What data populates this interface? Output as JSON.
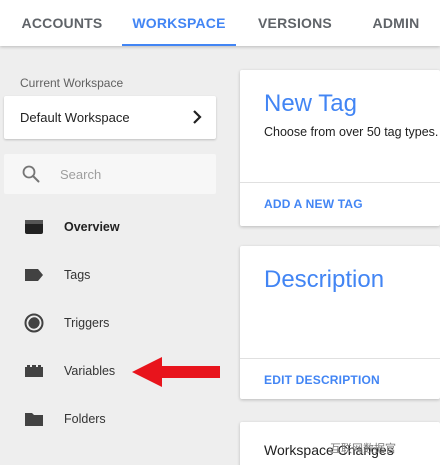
{
  "tabs": [
    {
      "label": "ACCOUNTS"
    },
    {
      "label": "WORKSPACE"
    },
    {
      "label": "VERSIONS"
    },
    {
      "label": "ADMIN"
    }
  ],
  "sidebar": {
    "current_workspace_label": "Current Workspace",
    "workspace_name": "Default Workspace",
    "search_placeholder": "Search",
    "items": [
      {
        "label": "Overview",
        "icon": "overview-icon"
      },
      {
        "label": "Tags",
        "icon": "tag-icon"
      },
      {
        "label": "Triggers",
        "icon": "trigger-icon"
      },
      {
        "label": "Variables",
        "icon": "variables-icon"
      },
      {
        "label": "Folders",
        "icon": "folder-icon"
      }
    ]
  },
  "cards": {
    "new_tag": {
      "title": "New Tag",
      "description": "Choose from over 50 tag types.",
      "action": "ADD A NEW TAG"
    },
    "description": {
      "title": "Description",
      "action": "EDIT DESCRIPTION"
    },
    "workspace_changes": {
      "title": "Workspace Changes"
    }
  },
  "watermark": "互联网数据官",
  "colors": {
    "accent": "#4285f4",
    "arrow": "#e8141c",
    "background": "#eeeeee"
  }
}
